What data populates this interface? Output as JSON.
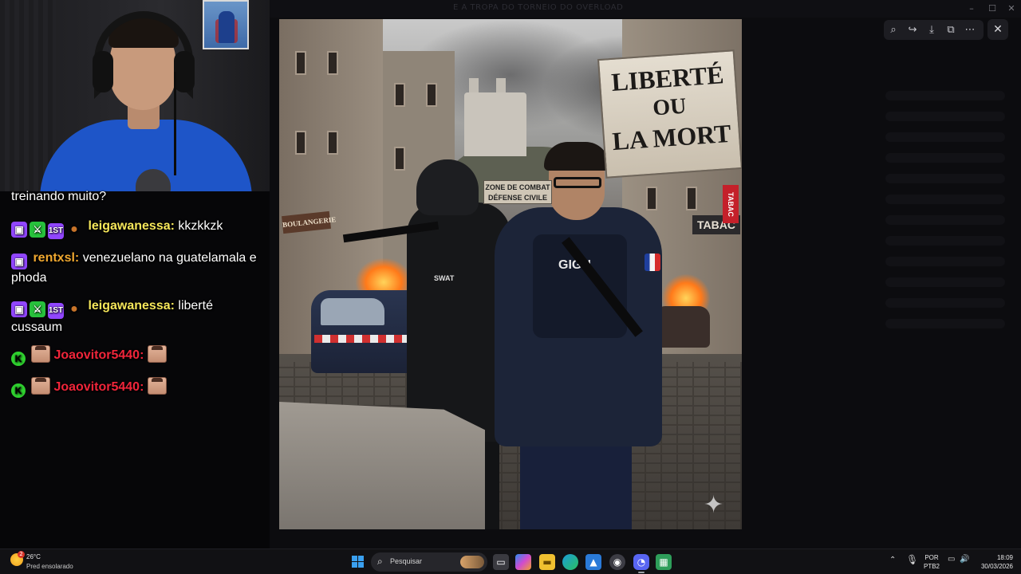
{
  "window": {
    "title": "E A TROPA DO TORNEIO DO OVERLOAD"
  },
  "chat": {
    "messages": [
      {
        "text": "treinando muito?"
      },
      {
        "username": "leigawanessa:",
        "text": " kkzkkzk"
      },
      {
        "username": "rentxsl:",
        "text": " venezuelano na guatelamala e phoda"
      },
      {
        "username": "leigawanessa:",
        "text": " liberté cussaum"
      },
      {
        "username": "Joaovitor5440:"
      },
      {
        "username": "Joaovitor5440:"
      }
    ]
  },
  "image": {
    "sign_main": [
      "LIBERTÉ",
      "OU",
      "LA MORT"
    ],
    "sign_zone": [
      "ZONE DE COMBAT",
      "DÉFENSE CIVILE"
    ],
    "sign_boulangerie": "BOULANGERIE",
    "sign_tabac": "TABAC",
    "vest_label": "GIGN",
    "soldier_label": "SWAT"
  },
  "viewer_toolbar": {
    "zoom_icon": "zoom-in-icon",
    "share_icon": "share-icon",
    "download_icon": "download-icon",
    "open_icon": "open-external-icon",
    "more_icon": "more-icon",
    "close_icon": "close-icon"
  },
  "taskbar": {
    "weather_temp": "26°C",
    "weather_condition": "Pred ensolarado",
    "weather_badge": "2",
    "search_placeholder": "Pesquisar",
    "lang_line1": "POR",
    "lang_line2": "PTB2",
    "time": "18:09",
    "date": "30/03/2026"
  },
  "colors": {
    "username_yellow": "#f5e65a",
    "username_orange": "#f0a830",
    "username_red": "#f0253a",
    "twitch_purple": "#9146ff",
    "kick_green": "#2fd12f"
  }
}
